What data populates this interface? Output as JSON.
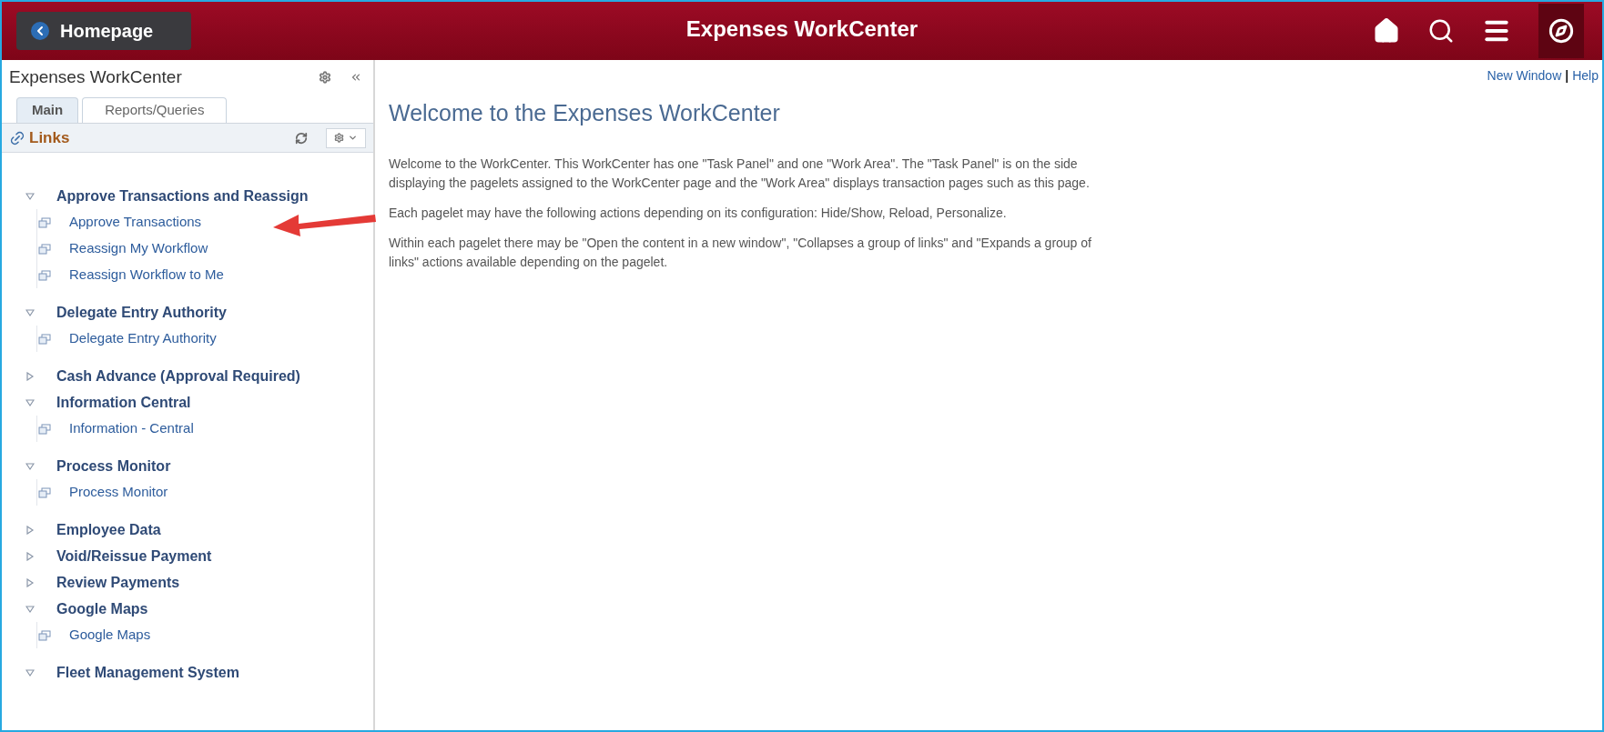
{
  "header": {
    "back_button": "Homepage",
    "title": "Expenses WorkCenter"
  },
  "sidebar": {
    "title": "Expenses WorkCenter",
    "tabs": [
      {
        "label": "Main",
        "selected": true
      },
      {
        "label": "Reports/Queries",
        "selected": false
      }
    ],
    "pagelet_title": "Links",
    "groups": [
      {
        "label": "Approve Transactions and Reassign",
        "expanded": true,
        "children": [
          {
            "label": "Approve Transactions"
          },
          {
            "label": "Reassign My Workflow"
          },
          {
            "label": "Reassign Workflow to Me"
          }
        ]
      },
      {
        "label": "Delegate Entry Authority",
        "expanded": true,
        "children": [
          {
            "label": "Delegate Entry Authority"
          }
        ]
      },
      {
        "label": "Cash Advance (Approval Required)",
        "expanded": false
      },
      {
        "label": "Information Central",
        "expanded": true,
        "children": [
          {
            "label": "Information - Central"
          }
        ]
      },
      {
        "label": "Process Monitor",
        "expanded": true,
        "children": [
          {
            "label": "Process Monitor"
          }
        ]
      },
      {
        "label": "Employee Data",
        "expanded": false
      },
      {
        "label": "Void/Reissue Payment",
        "expanded": false
      },
      {
        "label": "Review Payments",
        "expanded": false
      },
      {
        "label": "Google Maps",
        "expanded": true,
        "children": [
          {
            "label": "Google Maps"
          }
        ]
      },
      {
        "label": "Fleet Management System",
        "expanded": true
      }
    ]
  },
  "top_links": [
    "New Window",
    "|",
    "Help"
  ],
  "main": {
    "heading": "Welcome to the Expenses WorkCenter",
    "paragraphs": [
      "Welcome to the WorkCenter. This WorkCenter has one \"Task Panel\" and one \"Work Area\". The \"Task Panel\" is on the side displaying the pagelets assigned to the WorkCenter page and the \"Work Area\" displays transaction pages such as this page.",
      "Each pagelet may have the following actions depending on its configuration: Hide/Show, Reload, Personalize.",
      "Within each pagelet there may be \"Open the content in a new window\", \"Collapses a group of links\" and \"Expands a group of links\" actions available depending on the pagelet."
    ]
  }
}
